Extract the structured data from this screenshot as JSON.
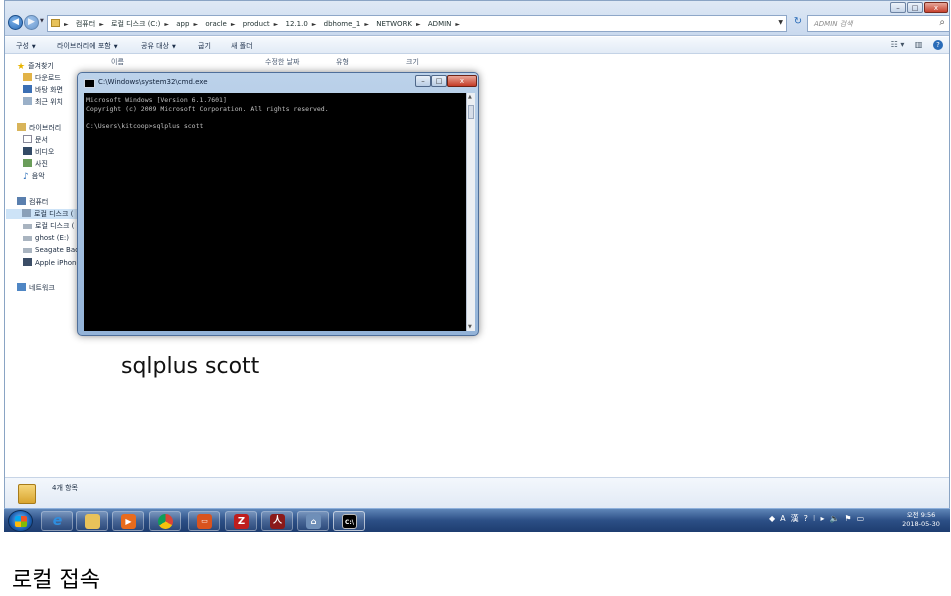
{
  "explorer": {
    "breadcrumb": [
      "컴퓨터",
      "로컬 디스크 (C:)",
      "app",
      "oracle",
      "product",
      "12.1.0",
      "dbhome_1",
      "NETWORK",
      "ADMIN"
    ],
    "search_placeholder": "ADMIN 검색",
    "toolbar": {
      "organize": "구성",
      "include_library": "라이브러리에 포함",
      "share_with": "공유 대상",
      "burn": "굽기",
      "new_folder": "새 폴더"
    },
    "columns": {
      "name": "이름",
      "modified": "수정한 날짜",
      "type": "유형",
      "size": "크기"
    },
    "nav": {
      "favorites": "즐겨찾기",
      "downloads": "다운로드",
      "desktop": "바탕 화면",
      "recent": "최근 위치",
      "libraries": "라이브러리",
      "documents": "문서",
      "videos": "비디오",
      "pictures": "사진",
      "music": "음악",
      "computer": "컴퓨터",
      "local_disk_1": "로컬 디스크 (",
      "local_disk_2": "로컬 디스크 (",
      "ghost": "ghost (E:)",
      "seagate": "Seagate Backu",
      "iphone": "Apple iPhone",
      "network": "네트워크"
    },
    "status": "4개 항목",
    "overlay_caption": "sqlplus scott"
  },
  "cmd": {
    "title": "C:\\Windows\\system32\\cmd.exe",
    "lines": [
      "Microsoft Windows [Version 6.1.7601]",
      "Copyright (c) 2009 Microsoft Corporation. All rights reserved.",
      "",
      "C:\\Users\\kitcoop>sqlplus scott"
    ]
  },
  "taskbar": {
    "clock_period": "오전 9:56",
    "clock_date": "2018-05-30",
    "ime_indicator": "A",
    "ime_hanja": "漢"
  },
  "page_caption": "로컬 접속"
}
